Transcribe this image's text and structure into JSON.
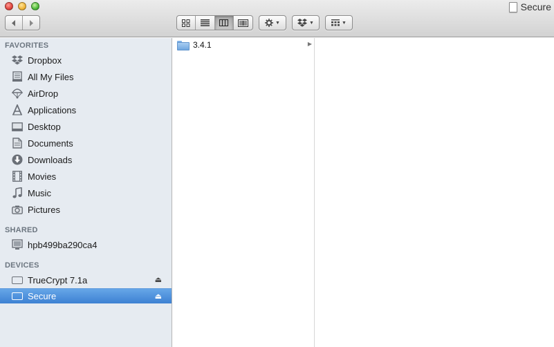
{
  "window": {
    "title": "Secure"
  },
  "toolbar": {
    "back_icon": "chevron-left-icon",
    "forward_icon": "chevron-right-icon",
    "views": [
      "icon-view",
      "list-view",
      "column-view",
      "coverflow-view"
    ],
    "active_view": "column-view"
  },
  "sidebar": {
    "favorites_header": "FAVORITES",
    "favorites": [
      {
        "label": "Dropbox",
        "icon": "dropbox-icon"
      },
      {
        "label": "All My Files",
        "icon": "all-files-icon"
      },
      {
        "label": "AirDrop",
        "icon": "airdrop-icon"
      },
      {
        "label": "Applications",
        "icon": "applications-icon"
      },
      {
        "label": "Desktop",
        "icon": "desktop-icon"
      },
      {
        "label": "Documents",
        "icon": "documents-icon"
      },
      {
        "label": "Downloads",
        "icon": "downloads-icon"
      },
      {
        "label": "Movies",
        "icon": "movies-icon"
      },
      {
        "label": "Music",
        "icon": "music-icon"
      },
      {
        "label": "Pictures",
        "icon": "pictures-icon"
      }
    ],
    "shared_header": "SHARED",
    "shared": [
      {
        "label": "hpb499ba290ca4",
        "icon": "shared-computer-icon"
      }
    ],
    "devices_header": "DEVICES",
    "devices": [
      {
        "label": "TrueCrypt 7.1a",
        "icon": "drive-icon",
        "ejectable": true,
        "selected": false
      },
      {
        "label": "Secure",
        "icon": "drive-icon",
        "ejectable": true,
        "selected": true
      }
    ]
  },
  "browser": {
    "columns": [
      [
        {
          "name": "3.4.1",
          "type": "folder",
          "has_children": true
        }
      ]
    ]
  },
  "colors": {
    "selection": "#3d81d3",
    "sidebar_bg": "#e6ebf1"
  }
}
